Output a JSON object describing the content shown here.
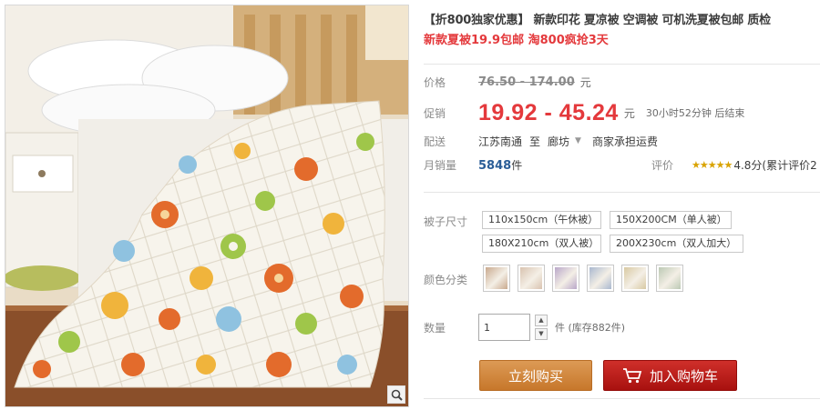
{
  "product": {
    "title": "【折800独家优惠】 新款印花 夏凉被 空调被 可机洗夏被包邮 质检",
    "subtitle": "新款夏被19.9包邮 淘800疯抢3天"
  },
  "price": {
    "label": "价格",
    "original": "76.50 - 174.00",
    "unit": "元"
  },
  "promo": {
    "label": "促销",
    "price": "19.92 - 45.24",
    "unit": "元",
    "countdown": "30小时52分钟 后结束"
  },
  "shipping": {
    "label": "配送",
    "from": "江苏南通",
    "to_word": "至",
    "destination": "廊坊",
    "fee_note": "商家承担运费"
  },
  "monthly_sales": {
    "label": "月销量",
    "count": "5848",
    "unit": "件"
  },
  "rating": {
    "label": "评价",
    "stars_glyph": "★★★★★",
    "text": "4.8分(累计评价2"
  },
  "size": {
    "label": "被子尺寸",
    "options": [
      "110x150cm（午休被）",
      "150X200CM（单人被）",
      "180X210cm（双人被）",
      "200X230cm（双人加大）"
    ]
  },
  "color": {
    "label": "颜色分类",
    "swatch_colors": [
      "#c9a98e",
      "#d9c3b0",
      "#b9a7c9",
      "#a9b8cf",
      "#d8c9a2",
      "#bcc9b4"
    ]
  },
  "quantity": {
    "label": "数量",
    "value": "1",
    "up_glyph": "▲",
    "down_glyph": "▼",
    "unit": "件",
    "stock": "(库存882件)"
  },
  "actions": {
    "buy_now": "立刻购买",
    "add_to_cart": "加入购物车"
  },
  "icons": {
    "zoom": "magnifier-icon",
    "cart": "cart-icon",
    "dropdown": "chevron-down-icon"
  },
  "colors": {
    "accent_red": "#e4393c",
    "buy_orange": "#c7772b",
    "cart_red": "#a8110f",
    "sales_blue": "#2a5d97"
  }
}
